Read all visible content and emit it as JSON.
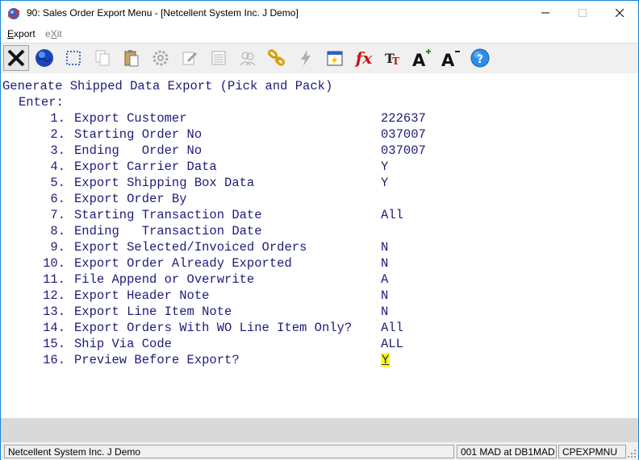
{
  "window": {
    "title": "90: Sales Order Export Menu - [Netcellent System Inc. J Demo]"
  },
  "menu": {
    "export": "Export",
    "exit": "eXit"
  },
  "toolbar": {
    "buttons": [
      "exit-icon",
      "globe-icon",
      "select-icon",
      "copy-icon",
      "paste-icon",
      "settings-icon",
      "edit-icon",
      "list-icon",
      "users-icon",
      "link-icon",
      "lightning-icon",
      "calendar-icon",
      "function-icon",
      "font-type-icon",
      "font-larger-icon",
      "font-smaller-icon",
      "help-icon"
    ],
    "fx_label": "fx"
  },
  "screen": {
    "heading": "Generate Shipped Data Export (Pick and Pack)",
    "enter": "Enter:",
    "rows": [
      {
        "num": "1.",
        "label": "Export Customer",
        "value": "222637"
      },
      {
        "num": "2.",
        "label": "Starting Order No",
        "value": "037007"
      },
      {
        "num": "3.",
        "label": "Ending   Order No",
        "value": "037007"
      },
      {
        "num": "4.",
        "label": "Export Carrier Data",
        "value": "Y"
      },
      {
        "num": "5.",
        "label": "Export Shipping Box Data",
        "value": "Y"
      },
      {
        "num": "6.",
        "label": "Export Order By",
        "value": ""
      },
      {
        "num": "7.",
        "label": "Starting Transaction Date",
        "value": "All"
      },
      {
        "num": "8.",
        "label": "Ending   Transaction Date",
        "value": ""
      },
      {
        "num": "9.",
        "label": "Export Selected/Invoiced Orders",
        "value": "N"
      },
      {
        "num": "10.",
        "label": "Export Order Already Exported",
        "value": "N"
      },
      {
        "num": "11.",
        "label": "File Append or Overwrite",
        "value": "A"
      },
      {
        "num": "12.",
        "label": "Export Header Note",
        "value": "N"
      },
      {
        "num": "13.",
        "label": "Export Line Item Note",
        "value": "N"
      },
      {
        "num": "14.",
        "label": "Export Orders With WO Line Item Only?",
        "value": "All"
      },
      {
        "num": "15.",
        "label": "Ship Via Code",
        "value": "ALL"
      },
      {
        "num": "16.",
        "label": "Preview Before Export?",
        "value": "Y"
      }
    ]
  },
  "status": {
    "company": "Netcellent System Inc. J Demo",
    "session": "001 MAD at DB1MAD",
    "program": "CPEXPMNU"
  },
  "colors": {
    "terminal_text": "#1c1c7c",
    "cursor_highlight": "#ffff00",
    "window_border": "#1883d7"
  }
}
